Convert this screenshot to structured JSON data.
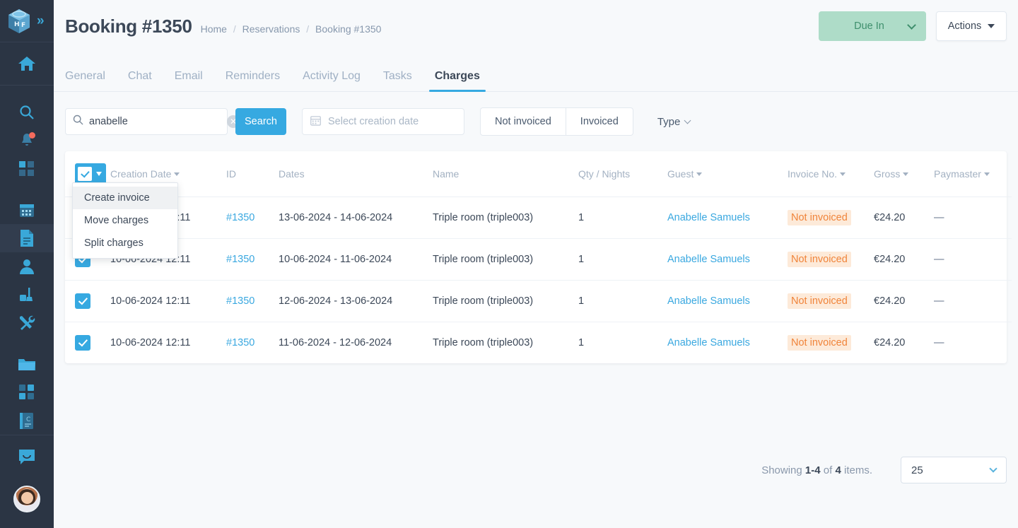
{
  "sidebar": {
    "logo": {
      "name": "hf-cube-logo",
      "text": "HF"
    },
    "expand_label": "»",
    "items": [
      {
        "icon": "home-icon",
        "label": "Home"
      },
      {
        "icon": "search-icon",
        "label": "Search"
      },
      {
        "icon": "bell-icon",
        "label": "Notifications",
        "badge": true
      },
      {
        "icon": "grid-icon",
        "label": "Dashboard"
      },
      {
        "icon": "calendar-icon",
        "label": "Calendar"
      },
      {
        "icon": "document-icon",
        "label": "Reservations",
        "active": true
      },
      {
        "icon": "person-icon",
        "label": "Guests"
      },
      {
        "icon": "housekeeping-icon",
        "label": "Housekeeping"
      },
      {
        "icon": "tools-icon",
        "label": "Maintenance"
      },
      {
        "icon": "folder-icon",
        "label": "Files"
      },
      {
        "icon": "apps-icon",
        "label": "Apps"
      },
      {
        "icon": "book-icon",
        "label": "Directory"
      },
      {
        "icon": "chat-icon",
        "label": "Messages"
      },
      {
        "icon": "avatar",
        "label": "Profile"
      }
    ]
  },
  "header": {
    "title": "Booking #1350",
    "breadcrumb": [
      "Home",
      "Reservations",
      "Booking #1350"
    ],
    "breadcrumb_sep": "/",
    "status_button": {
      "label": "Due In",
      "color": "#aedcc8",
      "text_color": "#3f8f6d"
    },
    "actions_button": {
      "label": "Actions"
    }
  },
  "tabs": [
    {
      "label": "General",
      "active": false
    },
    {
      "label": "Chat",
      "active": false
    },
    {
      "label": "Email",
      "active": false
    },
    {
      "label": "Reminders",
      "active": false
    },
    {
      "label": "Activity Log",
      "active": false
    },
    {
      "label": "Tasks",
      "active": false
    },
    {
      "label": "Charges",
      "active": true
    }
  ],
  "filters": {
    "search": {
      "value": "anabelle",
      "placeholder": "Search",
      "icon": "search-icon",
      "clear_icon": "clear-icon"
    },
    "search_button": "Search",
    "date": {
      "placeholder": "Select creation date",
      "value": "",
      "icon": "calendar-icon"
    },
    "toggle": [
      {
        "label": "Not invoiced"
      },
      {
        "label": "Invoiced"
      }
    ],
    "type_dropdown": "Type"
  },
  "menu": {
    "items": [
      {
        "label": "Create invoice",
        "hovered": true
      },
      {
        "label": "Move charges",
        "hovered": false
      },
      {
        "label": "Split charges",
        "hovered": false
      }
    ]
  },
  "table": {
    "columns": [
      {
        "label": "",
        "sortable": false
      },
      {
        "label": "Creation Date",
        "sortable": true
      },
      {
        "label": "ID",
        "sortable": false
      },
      {
        "label": "Dates",
        "sortable": false
      },
      {
        "label": "Name",
        "sortable": false
      },
      {
        "label": "Qty / Nights",
        "sortable": false
      },
      {
        "label": "Guest",
        "sortable": true
      },
      {
        "label": "Invoice No.",
        "sortable": true
      },
      {
        "label": "Gross",
        "sortable": true
      },
      {
        "label": "Paymaster",
        "sortable": true
      }
    ],
    "rows": [
      {
        "checked": true,
        "created": "10-06-2024 12:11",
        "id": "#1350",
        "dates": "13-06-2024 - 14-06-2024",
        "name": "Triple room (triple003)",
        "qty": "1",
        "guest": "Anabelle Samuels",
        "invoice": "Not invoiced",
        "gross": "€24.20",
        "paymaster": "—"
      },
      {
        "checked": true,
        "created": "10-06-2024 12:11",
        "id": "#1350",
        "dates": "10-06-2024 - 11-06-2024",
        "name": "Triple room (triple003)",
        "qty": "1",
        "guest": "Anabelle Samuels",
        "invoice": "Not invoiced",
        "gross": "€24.20",
        "paymaster": "—"
      },
      {
        "checked": true,
        "created": "10-06-2024 12:11",
        "id": "#1350",
        "dates": "12-06-2024 - 13-06-2024",
        "name": "Triple room (triple003)",
        "qty": "1",
        "guest": "Anabelle Samuels",
        "invoice": "Not invoiced",
        "gross": "€24.20",
        "paymaster": "—"
      },
      {
        "checked": true,
        "created": "10-06-2024 12:11",
        "id": "#1350",
        "dates": "11-06-2024 - 12-06-2024",
        "name": "Triple room (triple003)",
        "qty": "1",
        "guest": "Anabelle Samuels",
        "invoice": "Not invoiced",
        "gross": "€24.20",
        "paymaster": "—"
      }
    ]
  },
  "footer": {
    "showing_prefix": "Showing ",
    "showing_range": "1-4",
    "showing_mid": " of ",
    "showing_total": "4",
    "showing_suffix": " items.",
    "page_size": "25"
  },
  "colors": {
    "accent_blue": "#36a9e1",
    "link_blue": "#3aa8e0",
    "orange": "#f0843a",
    "orange_bg": "#fdead9",
    "sidebar_bg": "#2b3544",
    "green_bg": "#aedcc8"
  }
}
